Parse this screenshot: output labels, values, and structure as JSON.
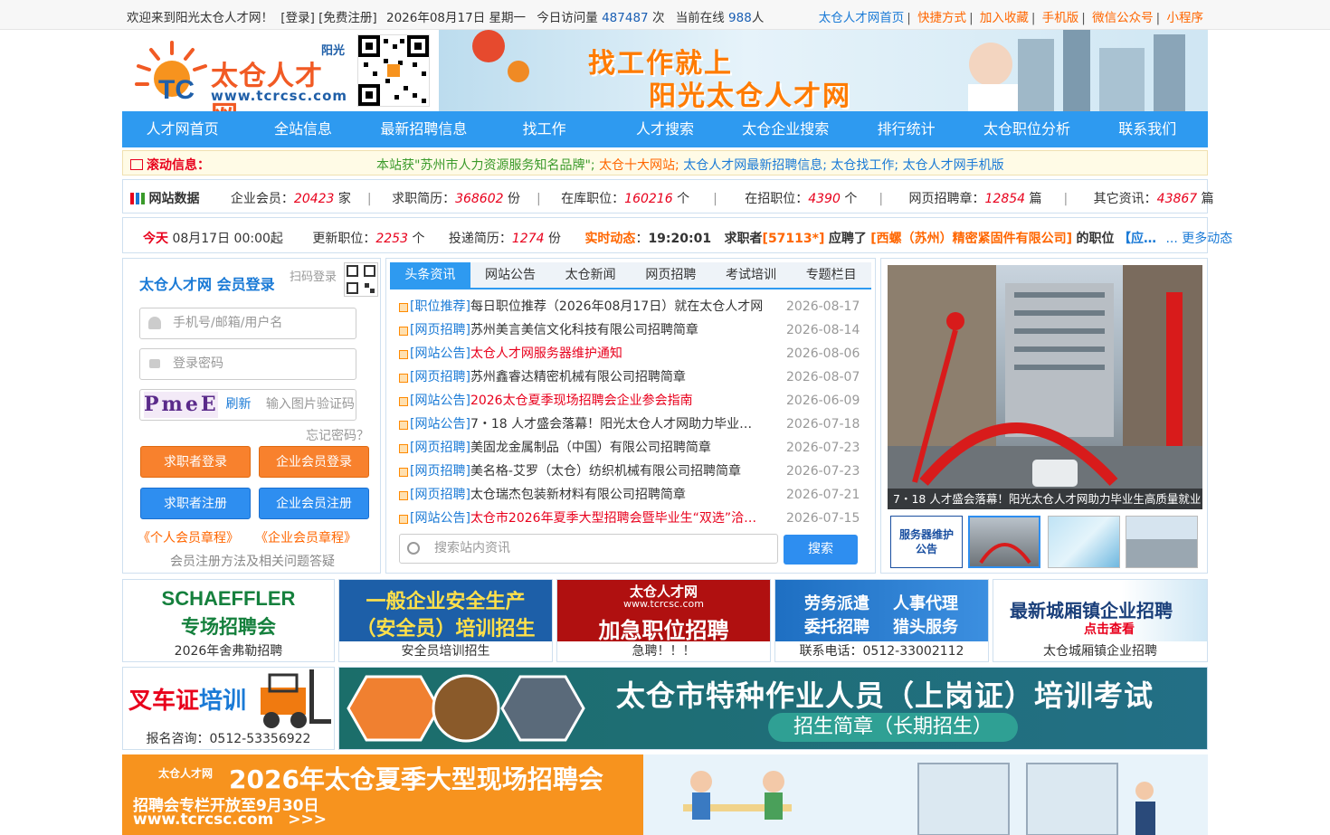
{
  "topbar": {
    "welcome": "欢迎来到阳光太仓人才网！",
    "login": "[登录]",
    "register": "[免费注册]",
    "date": "2026年08月17日 星期一",
    "visits_label": "今日访问量",
    "visits": "487487",
    "visits_unit": "次",
    "online_label": "当前在线",
    "online": "988",
    "online_unit": "人",
    "links": [
      "太仓人才网首页",
      "快捷方式",
      "加入收藏",
      "手机版",
      "微信公众号",
      "小程序"
    ]
  },
  "logo": {
    "brand": "太仓人才网",
    "badge": "阳光",
    "url": "www.tcrcsc.com"
  },
  "banner": {
    "line1": "找工作就上",
    "line2": "阳光太仓人才网"
  },
  "nav": [
    "人才网首页",
    "全站信息",
    "最新招聘信息",
    "找工作",
    "人才搜索",
    "太仓企业搜索",
    "排行统计",
    "太仓职位分析",
    "联系我们"
  ],
  "scroll": {
    "label": "滚动信息：",
    "m1": "本站获\"苏州市人力资源服务知名品牌\";",
    "m2": "太仓十大网站;",
    "m3": "太仓人才网最新招聘信息;",
    "m4": "太仓找工作;",
    "m5": "太仓人才网手机版"
  },
  "stats": {
    "label": "网站数据",
    "items": [
      {
        "k": "企业会员：",
        "v": "20423",
        "u": "家"
      },
      {
        "k": "求职简历：",
        "v": "368602",
        "u": "份"
      },
      {
        "k": "在库职位：",
        "v": "160216",
        "u": "个"
      },
      {
        "k": "在招职位：",
        "v": "4390",
        "u": "个"
      },
      {
        "k": "网页招聘章：",
        "v": "12854",
        "u": "篇"
      },
      {
        "k": "其它资讯：",
        "v": "43867",
        "u": "篇"
      }
    ]
  },
  "dynamic": {
    "today": "今天",
    "date": "08月17日 00:00起",
    "updated_label": "更新职位：",
    "updated": "2253",
    "updated_unit": "个",
    "resume_label": "投递简历：",
    "resume": "1274",
    "resume_unit": "份",
    "live_label": "实时动态",
    "time": "19:20:01",
    "seeker_pre": "求职者",
    "seeker": "[57113*]",
    "applied": "应聘了",
    "company": "[西螺（苏州）精密紧固件有限公司]",
    "job_pre": "的职位",
    "job": "【应…",
    "more": "... 更多动态"
  },
  "login": {
    "title": "太仓人才网 会员登录",
    "qr_label": "扫码登录",
    "user_ph": "手机号/邮箱/用户名",
    "pwd_ph": "登录密码",
    "captcha_text": "PmeE",
    "refresh": "刷新",
    "captcha_ph": "输入图片验证码",
    "forgot": "忘记密码？",
    "btn_seeker_login": "求职者登录",
    "btn_ent_login": "企业会员登录",
    "btn_seeker_reg": "求职者注册",
    "btn_ent_reg": "企业会员注册",
    "rule_person": "《个人会员章程》",
    "rule_ent": "《企业会员章程》",
    "help": "会员注册方法及相关问题答疑"
  },
  "news": {
    "tabs": [
      "头条资讯",
      "网站公告",
      "太仓新闻",
      "网页招聘",
      "考试培训",
      "专题栏目"
    ],
    "items": [
      {
        "cat": "[职位推荐]",
        "title": "每日职位推荐（2026年08月17日）就在太仓人才网",
        "date": "2026-08-17",
        "red": false
      },
      {
        "cat": "[网页招聘]",
        "title": "苏州美言美信文化科技有限公司招聘简章",
        "date": "2026-08-14",
        "red": false
      },
      {
        "cat": "[网站公告]",
        "title": "太仓人才网服务器维护通知",
        "date": "2026-08-06",
        "red": true
      },
      {
        "cat": "[网页招聘]",
        "title": "苏州鑫睿达精密机械有限公司招聘简章",
        "date": "2026-08-07",
        "red": false
      },
      {
        "cat": "[网站公告]",
        "title": "2026太仓夏季现场招聘会企业参会指南",
        "date": "2026-06-09",
        "red": true
      },
      {
        "cat": "[网站公告]",
        "title": "7・18 人才盛会落幕！阳光太仓人才网助力毕业…",
        "date": "2026-07-18",
        "red": false
      },
      {
        "cat": "[网页招聘]",
        "title": "美固龙金属制品（中国）有限公司招聘简章",
        "date": "2026-07-23",
        "red": false
      },
      {
        "cat": "[网页招聘]",
        "title": "美名格-艾罗（太仓）纺织机械有限公司招聘简章",
        "date": "2026-07-23",
        "red": false
      },
      {
        "cat": "[网页招聘]",
        "title": "太仓瑞杰包装新材料有限公司招聘简章",
        "date": "2026-07-21",
        "red": false
      },
      {
        "cat": "[网站公告]",
        "title": "太仓市2026年夏季大型招聘会暨毕业生“双选”洽…",
        "date": "2026-07-15",
        "red": true
      }
    ],
    "search_ph": "搜索站内资讯",
    "search_btn": "搜索"
  },
  "photo": {
    "caption": "7・18 人才盛会落幕！阳光太仓人才网助力毕业生高质量就业",
    "thumb1": "服务器维护公告"
  },
  "ads": [
    {
      "title": "SCHAEFFLER",
      "sub": "专场招聘会",
      "cap": "2026年舍弗勒招聘"
    },
    {
      "title": "一般企业安全生产",
      "sub": "（安全员）培训招生",
      "cap": "安全员培训招生"
    },
    {
      "title": "太仓人才网",
      "url": "www.tcrcsc.com",
      "sub": "加急职位招聘",
      "cap": "急聘！！！"
    },
    {
      "t1": "劳务派遣",
      "t2": "人事代理",
      "t3": "委托招聘",
      "t4": "猎头服务",
      "cap": "联系电话：0512-33002112"
    },
    {
      "title": "最新城厢镇企业招聘",
      "sub": "点击查看",
      "cap": "太仓城厢镇企业招聘"
    }
  ],
  "ad2": {
    "title1": "叉车证",
    "title2": "培训",
    "cap": "报名咨询：0512-53356922"
  },
  "ad3": {
    "title": "太仓市特种作业人员（上岗证）培训考试",
    "sub": "招生简章（长期招生）"
  },
  "ad4": {
    "title": "2026年太仓夏季大型现场招聘会",
    "sub": "招聘会专栏开放至9月30日",
    "url": "www.tcrcsc.com",
    "arrow": ">>>",
    "logo": "太仓人才网"
  }
}
